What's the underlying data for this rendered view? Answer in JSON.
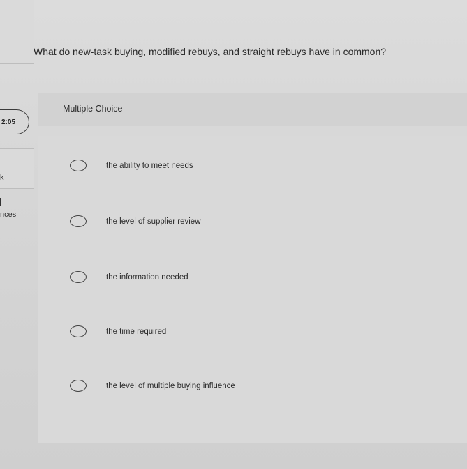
{
  "timer": {
    "value": "2:05"
  },
  "sidebar": {
    "fragment_1": "k",
    "fragment_2": "nces"
  },
  "question": {
    "text": "What do new-task buying, modified rebuys, and straight rebuys have in common?"
  },
  "question_type": {
    "label": "Multiple Choice"
  },
  "options": [
    {
      "label": "the ability to meet needs"
    },
    {
      "label": "the level of supplier review"
    },
    {
      "label": "the information needed"
    },
    {
      "label": "the time required"
    },
    {
      "label": "the level of multiple buying influence"
    }
  ]
}
